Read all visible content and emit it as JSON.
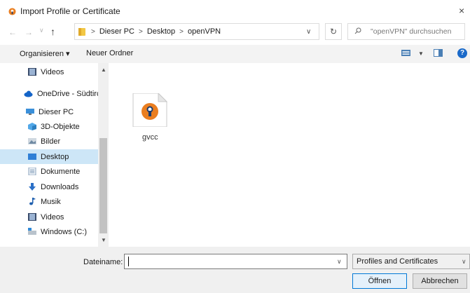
{
  "window": {
    "title": "Import Profile or Certificate",
    "close_glyph": "×"
  },
  "address": {
    "crumbs": [
      "Dieser PC",
      "Desktop",
      "openVPN"
    ],
    "search_placeholder": "\"openVPN\" durchsuchen"
  },
  "toolbar": {
    "organize_label": "Organisieren ▾",
    "new_folder_label": "Neuer Ordner",
    "help_glyph": "?"
  },
  "sidebar": {
    "items": [
      {
        "label": "Videos",
        "icon": "video-icon"
      },
      {
        "label": "OneDrive - Südtirc",
        "icon": "cloud-icon"
      },
      {
        "label": "Dieser PC",
        "icon": "computer-icon"
      },
      {
        "label": "3D-Objekte",
        "icon": "cube-icon"
      },
      {
        "label": "Bilder",
        "icon": "picture-icon"
      },
      {
        "label": "Desktop",
        "icon": "desktop-icon",
        "selected": true
      },
      {
        "label": "Dokumente",
        "icon": "document-icon"
      },
      {
        "label": "Downloads",
        "icon": "download-icon"
      },
      {
        "label": "Musik",
        "icon": "music-icon"
      },
      {
        "label": "Videos",
        "icon": "video-icon"
      },
      {
        "label": "Windows (C:)",
        "icon": "drive-icon"
      }
    ]
  },
  "files": [
    {
      "name": "gvcc",
      "icon": "openvpn-icon"
    }
  ],
  "bottom": {
    "filename_label": "Dateiname:",
    "filename_value": "",
    "filetype_value": "Profiles and Certificates",
    "open_label": "Öffnen",
    "cancel_label": "Abbrechen"
  },
  "colors": {
    "accent": "#0078d7",
    "selection": "#cde6f7",
    "openvpn_orange": "#ea7e20",
    "openvpn_navy": "#1c3c6e"
  }
}
